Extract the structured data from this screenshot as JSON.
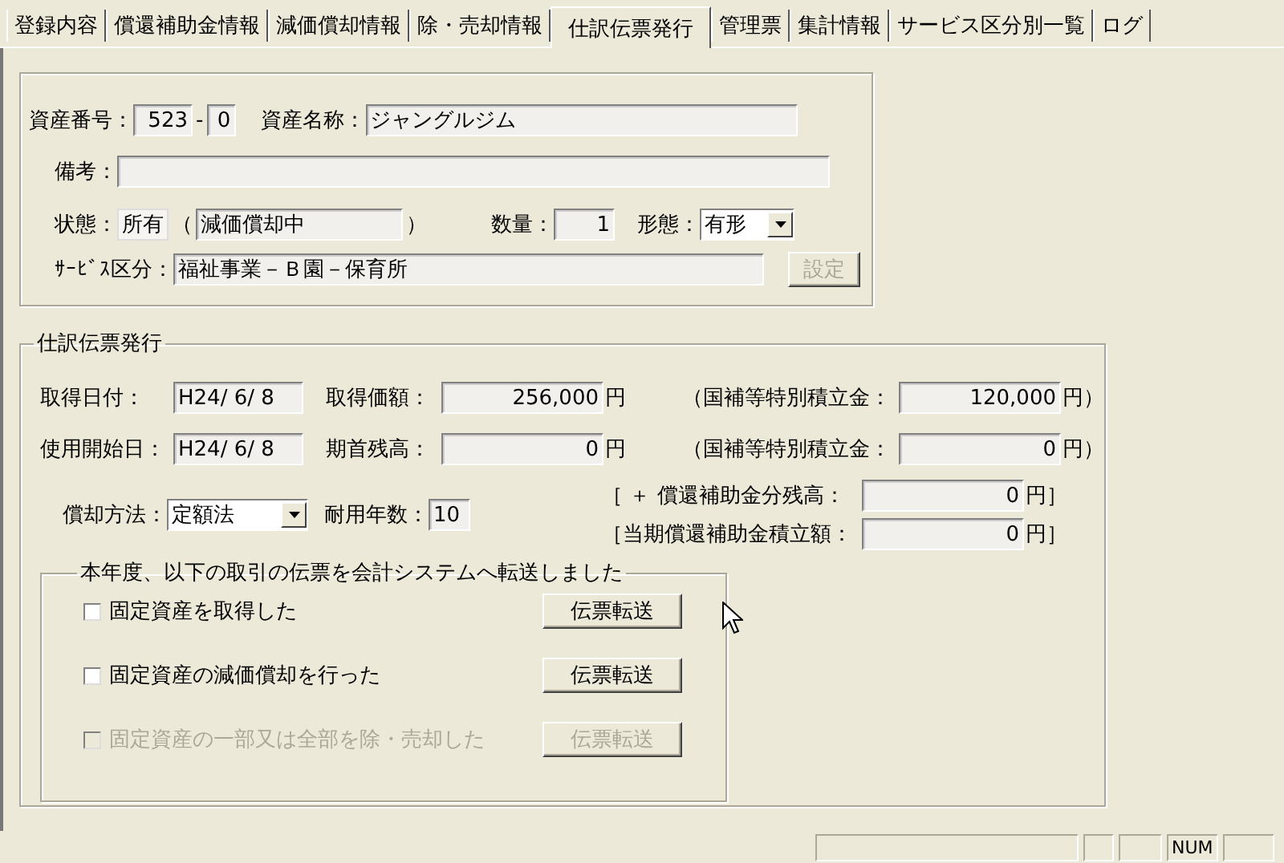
{
  "tabs": [
    {
      "label": "登録内容",
      "selected": false
    },
    {
      "label": "償還補助金情報",
      "selected": false
    },
    {
      "label": "減価償却情報",
      "selected": false
    },
    {
      "label": "除・売却情報",
      "selected": false
    },
    {
      "label": "仕訳伝票発行",
      "selected": true
    },
    {
      "label": "管理票",
      "selected": false
    },
    {
      "label": "集計情報",
      "selected": false
    },
    {
      "label": "サービス区分別一覧",
      "selected": false
    },
    {
      "label": "ログ",
      "selected": false
    }
  ],
  "asset": {
    "number_label": "資産番号：",
    "number": "523",
    "separator": "-",
    "sub_number": "0",
    "name_label": "資産名称：",
    "name": "ジャングルジム",
    "remarks_label": "備考：",
    "status_label": "状態：",
    "status": "所有",
    "open_paren": "（",
    "depreciation_status": "減価償却中",
    "close_paren": "）",
    "quantity_label": "数量：",
    "quantity": "1",
    "form_label": "形態：",
    "form": "有形",
    "service_label": "ｻｰﾋﾞｽ区分：",
    "service": "福祉事業－Ｂ園－保育所",
    "set_button": {
      "label": "設定",
      "disabled": true
    }
  },
  "voucher": {
    "title": "仕訳伝票発行",
    "top_rows": [
      [
        {
          "label": "取得日付：",
          "value": "H24/ 6/ 8"
        },
        {
          "label": "取得価額：",
          "value": "256,000",
          "unit": "円"
        },
        {
          "label": "（国補等特別積立金：",
          "value": "120,000",
          "unit": "円）"
        }
      ],
      [
        {
          "label": "使用開始日：",
          "value": "H24/ 6/ 8"
        },
        {
          "label": "期首残高：",
          "value": "0",
          "unit": "円"
        },
        {
          "label": "（国補等特別積立金：",
          "value": "0",
          "unit": "円）"
        }
      ]
    ],
    "method": {
      "label": "償却方法：",
      "value": "定額法"
    },
    "useful_life": {
      "label": "耐用年数：",
      "value": "10"
    },
    "balances": [
      {
        "label": "［ ＋ 償還補助金分残高：",
        "value": "0",
        "unit": "円］"
      },
      {
        "label": "［当期償還補助金積立額：",
        "value": "0",
        "unit": "円］"
      }
    ],
    "transfer": {
      "title": "本年度、以下の取引の伝票を会計システムへ転送しました",
      "items": [
        {
          "label": "固定資産を取得した",
          "checked": false,
          "disabled": false,
          "button": "伝票転送"
        },
        {
          "label": "固定資産の減価償却を行った",
          "checked": false,
          "disabled": false,
          "button": "伝票転送"
        },
        {
          "label": "固定資産の一部又は全部を除・売却した",
          "checked": false,
          "disabled": true,
          "button": "伝票転送"
        }
      ]
    }
  },
  "status_bar": {
    "num_indicator": "NUM"
  }
}
